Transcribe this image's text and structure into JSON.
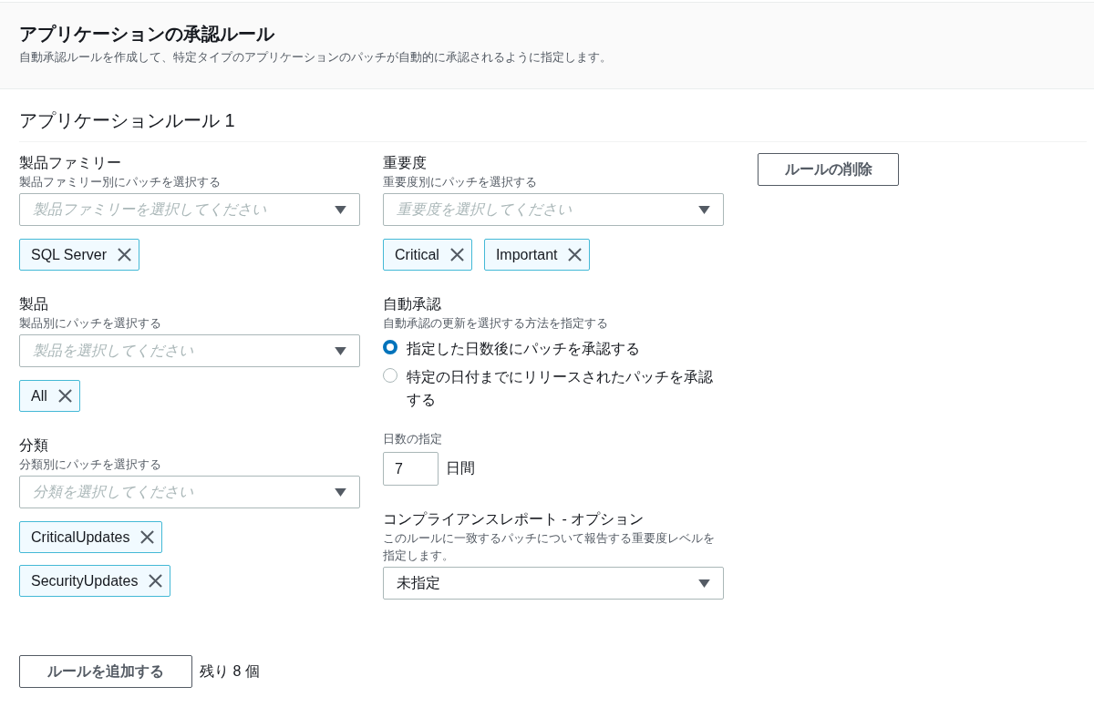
{
  "header": {
    "title": "アプリケーションの承認ルール",
    "description": "自動承認ルールを作成して、特定タイプのアプリケーションのパッチが自動的に承認されるように指定します。"
  },
  "rule": {
    "title": "アプリケーションルール 1",
    "delete_button": "ルールの削除",
    "left_fields": [
      {
        "kind": "multiselect",
        "label": "製品ファミリー",
        "description": "製品ファミリー別にパッチを選択する",
        "placeholder": "製品ファミリーを選択してください",
        "tokens": [
          "SQL Server"
        ]
      },
      {
        "kind": "multiselect",
        "label": "製品",
        "description": "製品別にパッチを選択する",
        "placeholder": "製品を選択してください",
        "tokens": [
          "All"
        ]
      },
      {
        "kind": "multiselect",
        "label": "分類",
        "description": "分類別にパッチを選択する",
        "placeholder": "分類を選択してください",
        "tokens": [
          "CriticalUpdates",
          "SecurityUpdates"
        ]
      }
    ],
    "right_fields": [
      {
        "kind": "multiselect",
        "label": "重要度",
        "description": "重要度別にパッチを選択する",
        "placeholder": "重要度を選択してください",
        "tokens": [
          "Critical",
          "Important"
        ]
      },
      {
        "kind": "radio",
        "label": "自動承認",
        "description": "自動承認の更新を選択する方法を指定する",
        "options": [
          {
            "label": "指定した日数後にパッチを承認する",
            "selected": true
          },
          {
            "label": "特定の日付までにリリースされたパッチを承認する",
            "selected": false
          }
        ]
      },
      {
        "kind": "number",
        "label": "日数の指定",
        "value": "7",
        "unit": "日間"
      },
      {
        "kind": "select",
        "label": "コンプライアンスレポート - オプション",
        "description": "このルールに一致するパッチについて報告する重要度レベルを指定します。",
        "value": "未指定"
      }
    ]
  },
  "footer": {
    "add_button": "ルールを追加する",
    "remaining": "残り 8 個"
  }
}
